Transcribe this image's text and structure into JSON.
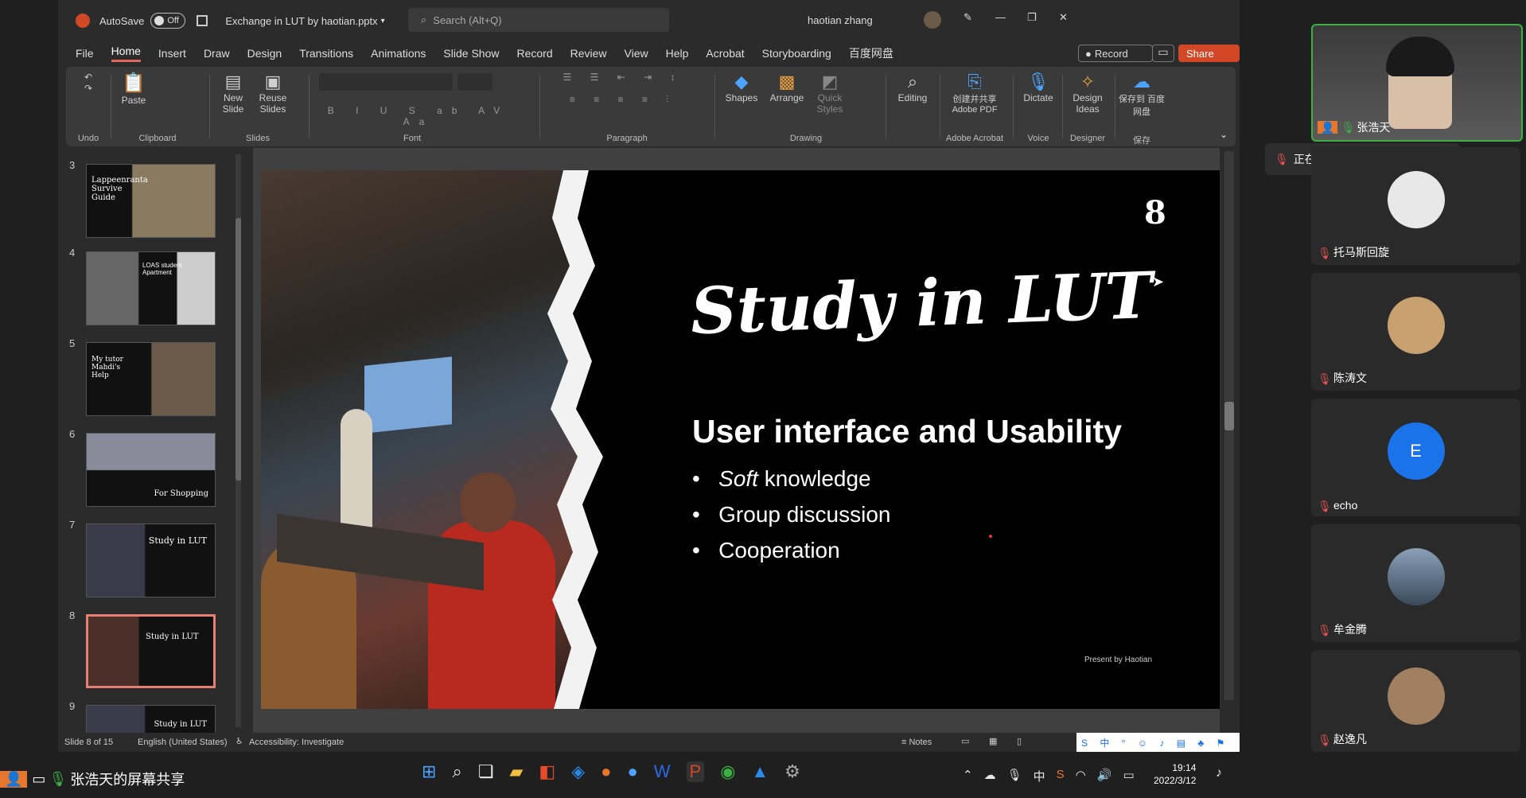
{
  "titlebar": {
    "autosave": "AutoSave",
    "autosave_state": "Off",
    "doc_title": "Exchange in LUT by haotian.pptx",
    "search_placeholder": "Search (Alt+Q)",
    "user_name": "haotian zhang"
  },
  "menu": [
    "File",
    "Home",
    "Insert",
    "Draw",
    "Design",
    "Transitions",
    "Animations",
    "Slide Show",
    "Record",
    "Review",
    "View",
    "Help",
    "Acrobat",
    "Storyboarding",
    "百度网盘"
  ],
  "record_label": "Record",
  "share_label": "Share",
  "ribbon": {
    "undo": "Undo",
    "clipboard": "Clipboard",
    "paste": "Paste",
    "new_slide": "New Slide",
    "reuse_slides": "Reuse Slides",
    "slides": "Slides",
    "font": "Font",
    "paragraph": "Paragraph",
    "shapes": "Shapes",
    "arrange": "Arrange",
    "quick_styles": "Quick Styles",
    "drawing": "Drawing",
    "editing": "Editing",
    "adobe_pdf": "创建并共享 Adobe PDF",
    "adobe_acrobat": "Adobe Acrobat",
    "dictate": "Dictate",
    "voice": "Voice",
    "design_ideas": "Design Ideas",
    "designer": "Designer",
    "save_baidu": "保存到 百度网盘",
    "save_group": "保存"
  },
  "thumbnails": [
    {
      "num": "3",
      "text": "Lappeenranta Survive Guide"
    },
    {
      "num": "4",
      "text": "LOAS student Apartment"
    },
    {
      "num": "5",
      "text": "My tutor Mahdi's Help"
    },
    {
      "num": "6",
      "text": "For Shopping"
    },
    {
      "num": "7",
      "text": "Study in LUT"
    },
    {
      "num": "8",
      "text": "Study in LUT"
    },
    {
      "num": "9",
      "text": "Study in LUT"
    }
  ],
  "slide": {
    "page_number": "8",
    "title": "Study in LUT",
    "subtitle": "User interface and Usability",
    "bullets": [
      {
        "em": "Soft",
        "rest": " knowledge"
      },
      {
        "em": "",
        "rest": "Group discussion"
      },
      {
        "em": "",
        "rest": "Cooperation"
      }
    ],
    "presenter": "Present by Haotian"
  },
  "status": {
    "slide_count": "Slide 8 of 15",
    "language": "English (United States)",
    "accessibility": "Accessibility: Investigate",
    "notes": "Notes"
  },
  "taskbar": {
    "share_text": "张浩天的屏幕共享",
    "time": "19:14",
    "date": "2022/3/12"
  },
  "participants": {
    "speaking": "正在讲话: 张浩天",
    "list": [
      {
        "name": "张浩天",
        "color": "#3a3a3a"
      },
      {
        "name": "托马斯回旋",
        "color": "#ddd"
      },
      {
        "name": "陈涛文",
        "color": "#c9a070"
      },
      {
        "name": "echo",
        "color": "#1a73e8",
        "initial": "E"
      },
      {
        "name": "牟金腾",
        "color": "#5a6a7a"
      },
      {
        "name": "赵逸凡",
        "color": "#a08060"
      }
    ]
  }
}
